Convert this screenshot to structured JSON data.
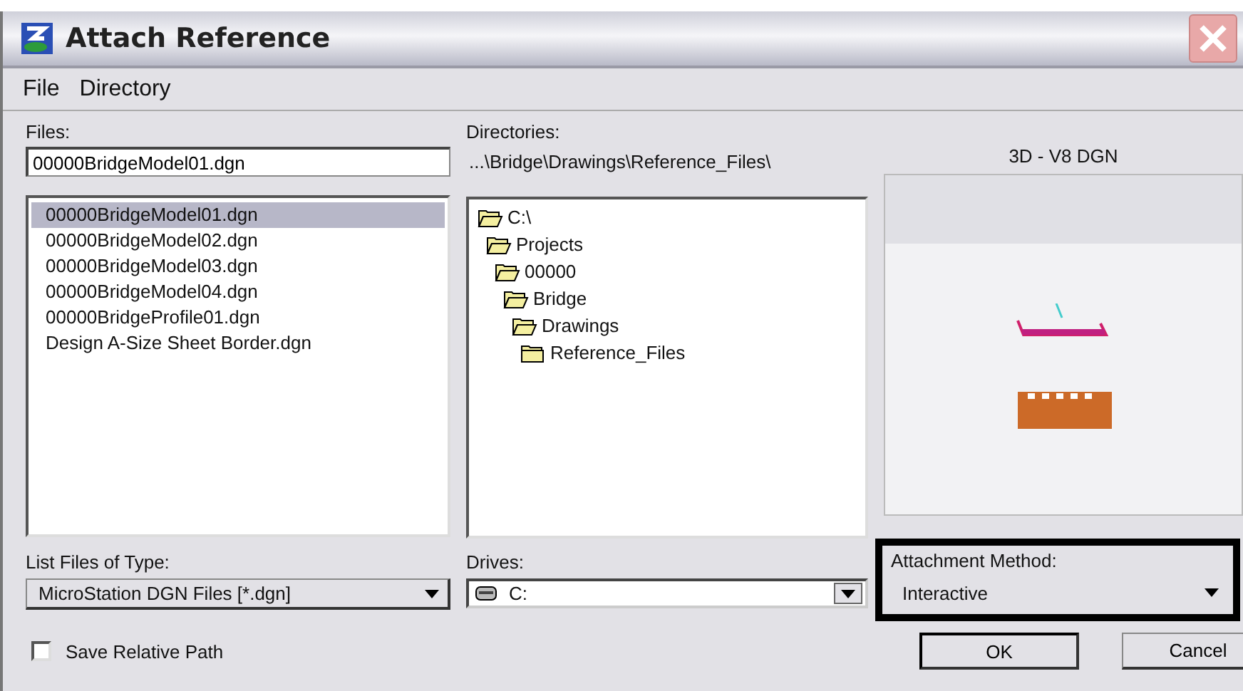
{
  "window": {
    "title": "Attach Reference"
  },
  "menu": [
    "File",
    "Directory"
  ],
  "files": {
    "label": "Files:",
    "value": "00000BridgeModel01.dgn",
    "items": [
      {
        "name": "00000BridgeModel01.dgn",
        "selected": true
      },
      {
        "name": "00000BridgeModel02.dgn",
        "selected": false
      },
      {
        "name": "00000BridgeModel03.dgn",
        "selected": false
      },
      {
        "name": "00000BridgeModel04.dgn",
        "selected": false
      },
      {
        "name": "00000BridgeProfile01.dgn",
        "selected": false
      },
      {
        "name": "Design A-Size Sheet Border.dgn",
        "selected": false
      }
    ]
  },
  "directories": {
    "label": "Directories:",
    "path": "...\\Bridge\\Drawings\\Reference_Files\\",
    "tree": [
      {
        "name": "C:\\",
        "children": [
          {
            "name": "Projects",
            "children": [
              {
                "name": "00000",
                "children": [
                  {
                    "name": "Bridge",
                    "children": [
                      {
                        "name": "Drawings",
                        "children": [
                          {
                            "name": "Reference_Files"
                          }
                        ]
                      }
                    ]
                  }
                ]
              }
            ]
          }
        ]
      }
    ]
  },
  "preview": {
    "label": "3D - V8 DGN"
  },
  "file_type": {
    "label": "List Files of Type:",
    "value": "MicroStation DGN Files [*.dgn]"
  },
  "drives": {
    "label": "Drives:",
    "value": "C:"
  },
  "attachment_method": {
    "label": "Attachment Method:",
    "value": "Interactive"
  },
  "save_relative_path": {
    "label": "Save Relative Path",
    "checked": false
  },
  "buttons": [
    "OK",
    "Cancel"
  ]
}
